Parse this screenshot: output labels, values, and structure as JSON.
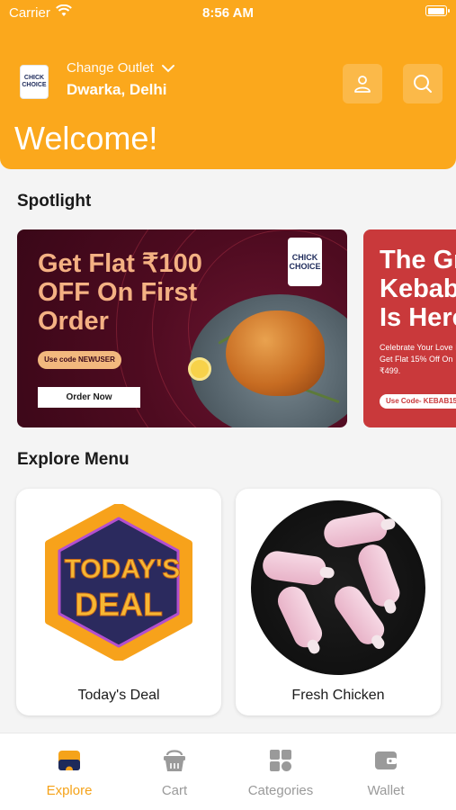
{
  "status_bar": {
    "carrier": "Carrier",
    "time": "8:56 AM"
  },
  "header": {
    "change_outlet_label": "Change Outlet",
    "location": "Dwarka, Delhi",
    "welcome": "Welcome!",
    "logo_line1": "CHICK",
    "logo_line2": "CHOICE"
  },
  "spotlight": {
    "title": "Spotlight",
    "banners": [
      {
        "headline": "Get Flat ₹100 OFF On First Order",
        "code": "Use code NEWUSER",
        "cta": "Order Now",
        "logo_line1": "CHICK",
        "logo_line2": "CHOICE"
      },
      {
        "headline": "The Gre\nKebab\nIs Here",
        "text": "Celebrate Your Love I\nGet Flat 15% Off On\n₹499.",
        "code": "Use Code- KEBAB15"
      }
    ]
  },
  "explore_menu": {
    "title": "Explore Menu",
    "items": [
      {
        "label": "Today's Deal",
        "badge_line1": "TODAY'S",
        "badge_line2": "DEAL"
      },
      {
        "label": "Fresh Chicken"
      }
    ]
  },
  "tab_bar": {
    "tabs": [
      {
        "label": "Explore",
        "icon": "explore-icon",
        "active": true
      },
      {
        "label": "Cart",
        "icon": "basket-icon",
        "active": false
      },
      {
        "label": "Categories",
        "icon": "grid-icon",
        "active": false
      },
      {
        "label": "Wallet",
        "icon": "wallet-icon",
        "active": false
      }
    ]
  },
  "colors": {
    "brand_orange": "#fba81c",
    "active_tab": "#f5a31a",
    "inactive_tab": "#9a9a9a",
    "banner_maroon": "#4e0b20",
    "banner_red": "#c9393b"
  }
}
